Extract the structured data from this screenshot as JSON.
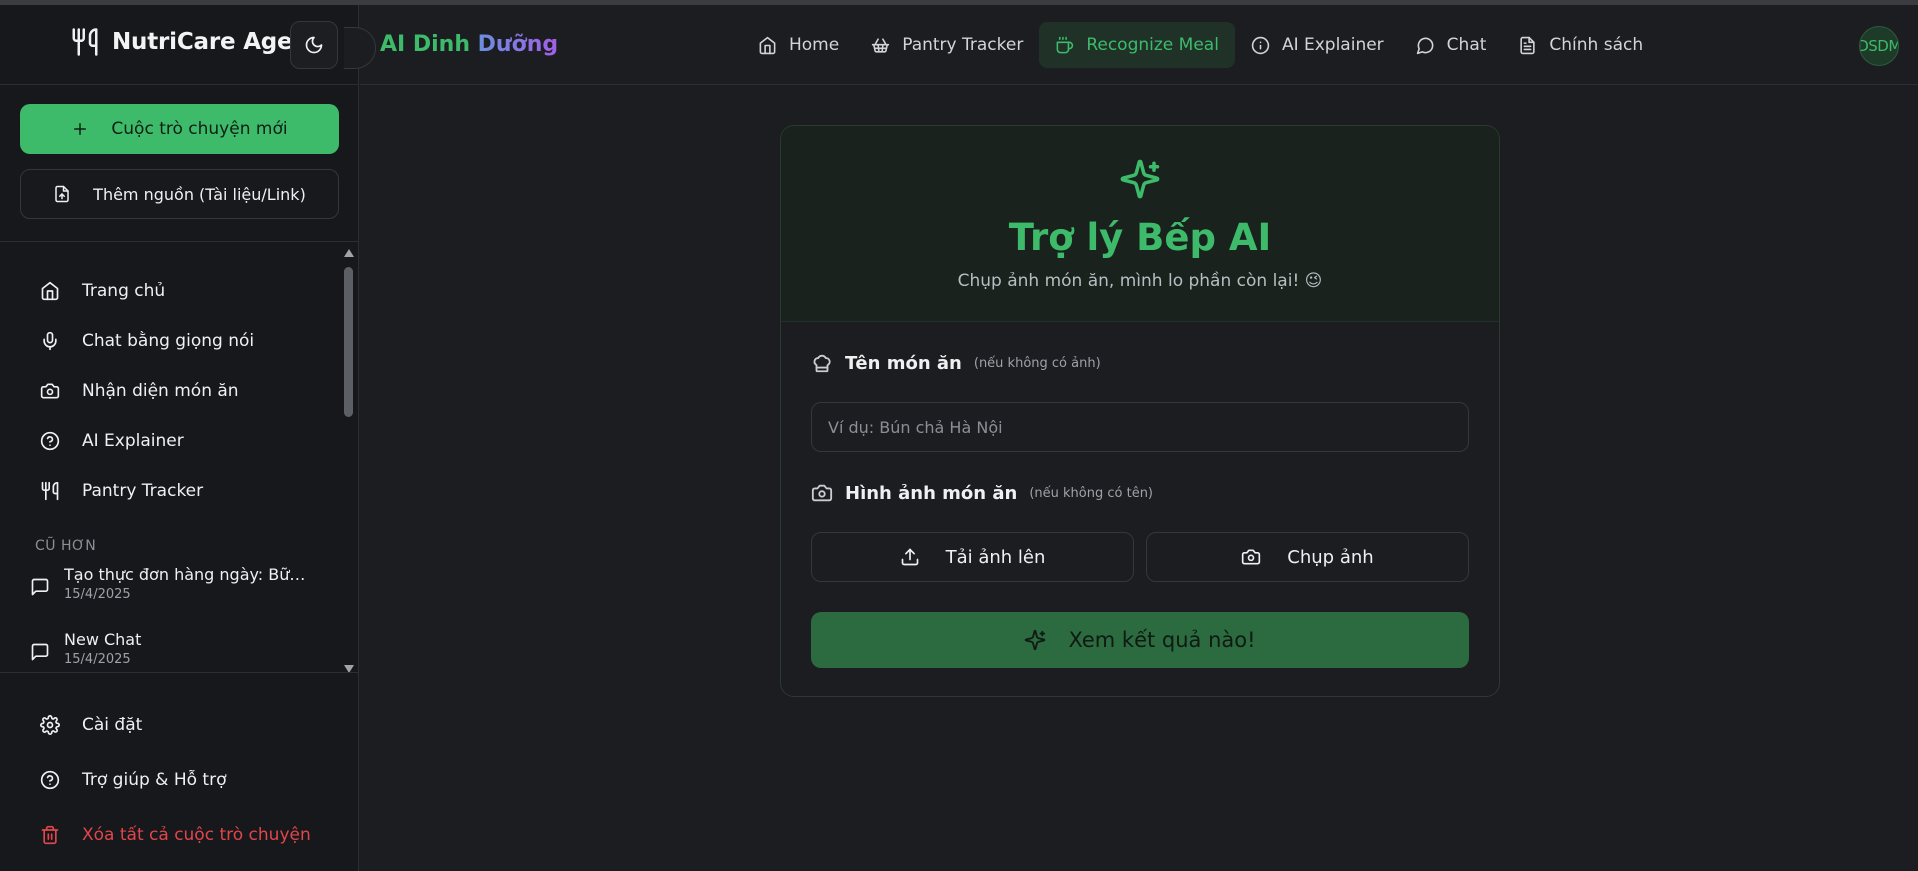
{
  "sidebar": {
    "brand": "NutriCare Agents",
    "buttons": {
      "new_chat": "Cuộc trò chuyện mới",
      "add_source": "Thêm nguồn (Tài liệu/Link)"
    },
    "nav": [
      {
        "label": "Trang chủ",
        "icon": "home-icon"
      },
      {
        "label": "Chat bằng giọng nói",
        "icon": "microphone-icon"
      },
      {
        "label": "Nhận diện món ăn",
        "icon": "camera-icon"
      },
      {
        "label": "AI Explainer",
        "icon": "help-circle-icon"
      },
      {
        "label": "Pantry Tracker",
        "icon": "utensils-icon"
      }
    ],
    "section_older": "CŨ HƠN",
    "history": [
      {
        "title": "Tạo thực đơn hàng ngày: Bữa...",
        "date": "15/4/2025"
      },
      {
        "title": "New Chat",
        "date": "15/4/2025"
      }
    ],
    "bottom": {
      "settings": "Cài đặt",
      "help": "Trợ giúp & Hỗ trợ",
      "delete_all": "Xóa tất cả cuộc trò chuyện"
    }
  },
  "header": {
    "title_green": "AI Dinh ",
    "title_purple": "Dưỡng",
    "tabs": [
      {
        "label": "Home",
        "icon": "home-icon",
        "active": false
      },
      {
        "label": "Pantry Tracker",
        "icon": "basket-icon",
        "active": false
      },
      {
        "label": "Recognize Meal",
        "icon": "cup-icon",
        "active": true
      },
      {
        "label": "AI Explainer",
        "icon": "info-icon",
        "active": false
      },
      {
        "label": "Chat",
        "icon": "chat-icon",
        "active": false
      },
      {
        "label": "Chính sách",
        "icon": "document-icon",
        "active": false
      }
    ],
    "avatar_text": "DSDM"
  },
  "card": {
    "title": "Trợ lý Bếp AI",
    "subtitle": "Chụp ảnh món ăn, mình lo phần còn lại! 😉",
    "dish_label": "Tên món ăn",
    "dish_hint": "(nếu không có ảnh)",
    "dish_placeholder": "Ví dụ: Bún chả Hà Nội",
    "image_label": "Hình ảnh món ăn",
    "image_hint": "(nếu không có tên)",
    "upload_label": "Tải ảnh lên",
    "capture_label": "Chụp ảnh",
    "submit_label": "Xem kết quả nào!"
  },
  "colors": {
    "accent": "#3dbb6a",
    "accent_dark": "#2c6a40",
    "danger": "#e0464b",
    "background": "#1b1d20"
  }
}
